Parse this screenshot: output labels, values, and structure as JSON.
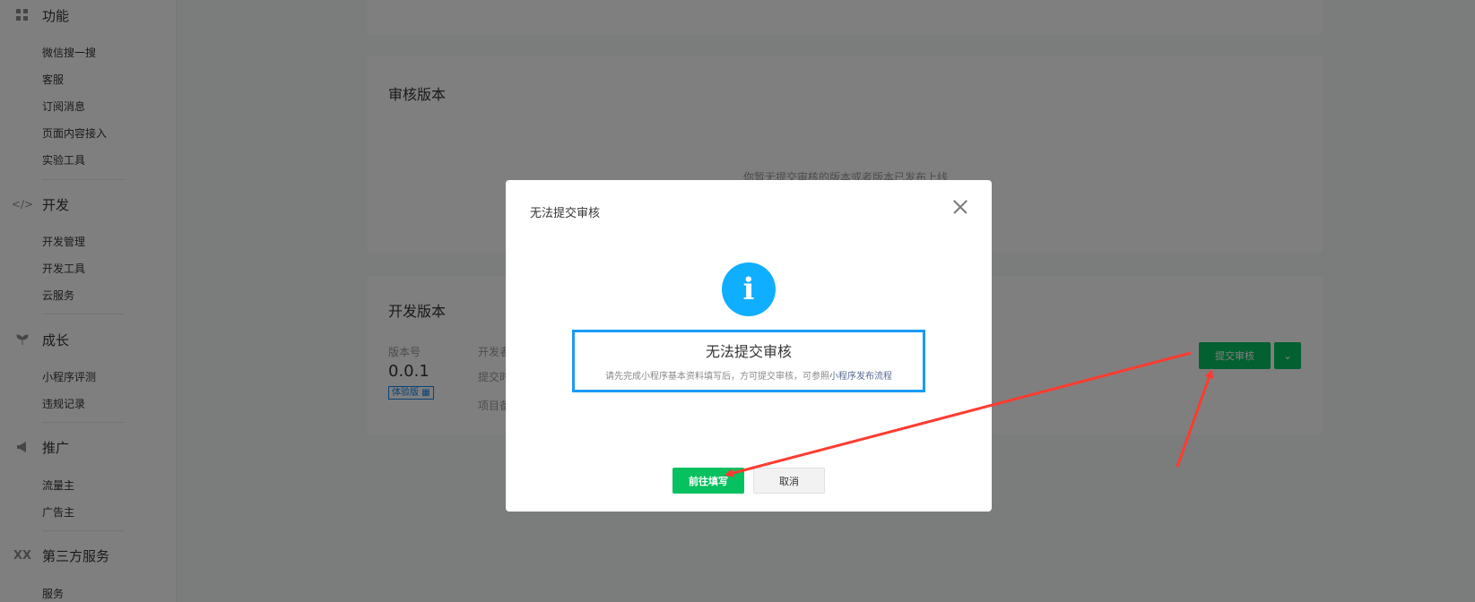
{
  "sidebar": {
    "group_features": {
      "label": "功能",
      "icon": "grid-icon"
    },
    "features_items": [
      "微信搜一搜",
      "客服",
      "订阅消息",
      "页面内容接入",
      "实验工具"
    ],
    "group_dev": {
      "label": "开发",
      "icon": "code-icon"
    },
    "dev_items": [
      "开发管理",
      "开发工具",
      "云服务"
    ],
    "group_growth": {
      "label": "成长",
      "icon": "sprout-icon"
    },
    "growth_items": [
      "小程序评测",
      "违规记录"
    ],
    "group_promo": {
      "label": "推广",
      "icon": "megaphone-icon"
    },
    "promo_items": [
      "流量主",
      "广告主"
    ],
    "group_third": {
      "label": "第三方服务",
      "icon": "third-party-icon"
    },
    "third_items": [
      "服务"
    ]
  },
  "main": {
    "review_title": "审核版本",
    "review_empty": "你暂无提交审核的版本或者版本已发布上线",
    "dev_title": "开发版本",
    "version_label": "版本号",
    "version_value": "0.0.1",
    "version_tag": "体验版 ",
    "dev_label_partial": "开发者",
    "submit_time_partial": "提交时",
    "project_partial": "项目备",
    "submit_button": "提交审核"
  },
  "dialog": {
    "title": "无法提交审核",
    "message_title": "无法提交审核",
    "message_desc": "请先完成小程序基本资料填写后，方可提交审核，可参照",
    "message_link": "小程序发布流程",
    "primary_button": "前往填写",
    "cancel_button": "取消"
  },
  "colors": {
    "accent_green": "#07c160",
    "info_blue": "#10aeff",
    "annotation_red": "#ff3b30"
  }
}
